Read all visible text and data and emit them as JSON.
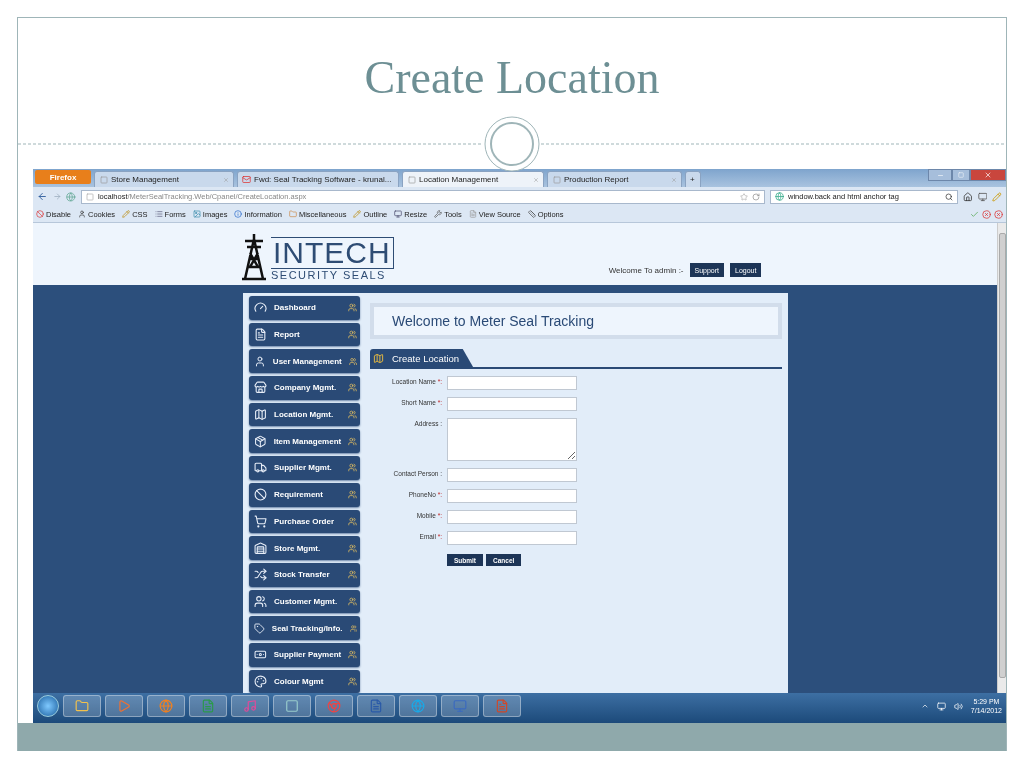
{
  "slide": {
    "title": "Create Location"
  },
  "browser": {
    "menu_button": "Firefox",
    "tabs": [
      {
        "label": "Store Management",
        "selected": false,
        "mail": false
      },
      {
        "label": "Fwd: Seal Tracking Software - krunal...",
        "selected": false,
        "mail": true
      },
      {
        "label": "Location Management",
        "selected": true,
        "mail": false
      },
      {
        "label": "Production Report",
        "selected": false,
        "mail": false
      }
    ],
    "new_tab": "+",
    "url_host": "localhost",
    "url_path": "/MeterSealTracking.Web/Cpanel/CreateLocation.aspx",
    "search_value": "window.back and html anchor tag",
    "toolbar": [
      "Disable",
      "Cookies",
      "CSS",
      "Forms",
      "Images",
      "Information",
      "Miscellaneous",
      "Outline",
      "Resize",
      "Tools",
      "View Source",
      "Options"
    ]
  },
  "page": {
    "logo_name": "INTECH",
    "logo_tagline": "SECURITY SEALS",
    "welcome": "Welcome To admin :-",
    "header_buttons": [
      "Support",
      "Logout"
    ],
    "menu": [
      "Dashboard",
      "Report",
      "User Management",
      "Company Mgmt.",
      "Location Mgmt.",
      "Item Management",
      "Supplier Mgmt.",
      "Requirement",
      "Purchase Order",
      "Store Mgmt.",
      "Stock Transfer",
      "Customer Mgmt.",
      "Seal Tracking/Info.",
      "Supplier Payment",
      "Colour Mgmt"
    ],
    "banner": "Welcome to Meter Seal Tracking",
    "section_title": "Create Location",
    "fields": [
      {
        "label": "Location Name",
        "required_mark": "*:",
        "kind": "input"
      },
      {
        "label": "Short Name",
        "required_mark": "*:",
        "kind": "input"
      },
      {
        "label": "Address :",
        "kind": "textarea"
      },
      {
        "label": "Contact Person :",
        "kind": "input"
      },
      {
        "label": "PhoneNo",
        "required_mark": "*:",
        "kind": "input"
      },
      {
        "label": "Mobile",
        "required_mark": "*:",
        "kind": "input"
      },
      {
        "label": "Email",
        "required_mark": "*:",
        "kind": "input"
      }
    ],
    "buttons": [
      "Submit",
      "Cancel"
    ]
  },
  "taskbar": {
    "time": "5:29 PM",
    "date": "7/14/2012"
  }
}
